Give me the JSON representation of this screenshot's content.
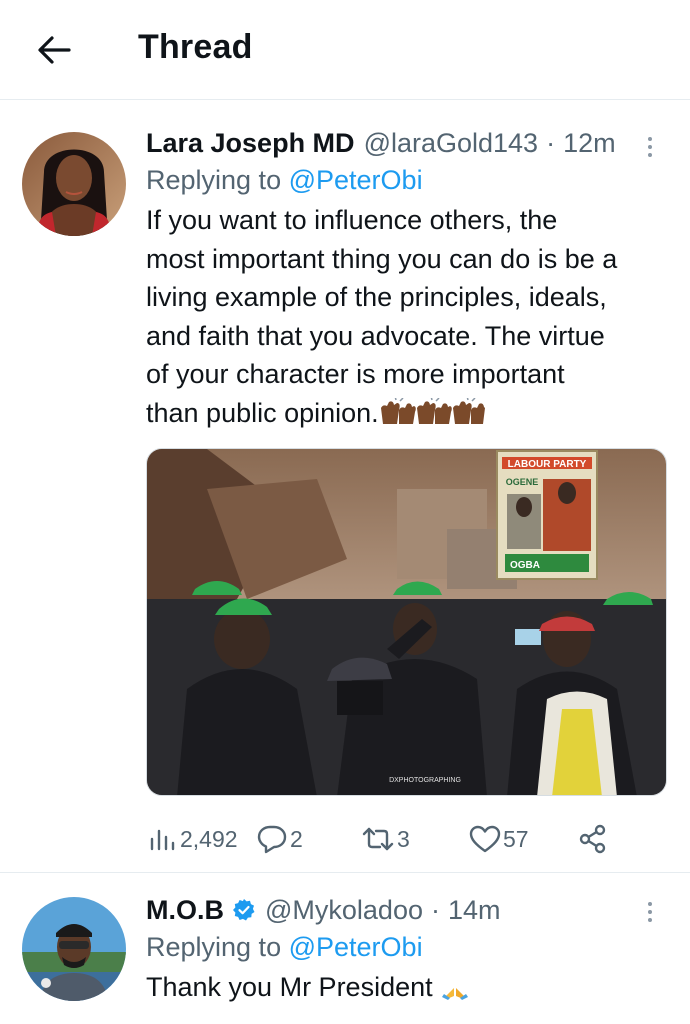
{
  "header": {
    "title": "Thread"
  },
  "tweets": [
    {
      "display_name": "Lara Joseph MD",
      "handle": "@laraGold143",
      "separator": "·",
      "time": "12m",
      "replying_prefix": "Replying to",
      "replying_to": "@PeterObi",
      "lines": [
        "If you want to influence others, the",
        "most important thing you can do is be a",
        "living example of the principles, ideals,",
        "and faith that you advocate. The virtue",
        "of your character is more important",
        "than public opinion."
      ],
      "media": {
        "placard_top": "LABOUR PARTY",
        "placard_mid": "OGENE",
        "placard_bottom": "OGBA",
        "watermark": "DXPHOTOGRAPHING"
      },
      "stats": {
        "views": "2,492",
        "replies": "2",
        "retweets": "3",
        "likes": "57"
      }
    },
    {
      "display_name": "M.O.B",
      "handle": "@Mykoladoo",
      "separator": "·",
      "time": "14m",
      "replying_prefix": "Replying to",
      "replying_to": "@PeterObi",
      "lines": [
        "Thank you Mr President"
      ]
    }
  ],
  "colors": {
    "accent": "#1d9bf0",
    "secondary_text": "#536471",
    "primary_text": "#0f1419",
    "divider": "#e6ecf0"
  },
  "icons": [
    "back-arrow-icon",
    "more-dots-icon",
    "views-icon",
    "reply-icon",
    "retweet-icon",
    "like-icon",
    "share-icon",
    "verified-badge-icon",
    "clapping-hands-emoji",
    "folded-hands-emoji"
  ]
}
